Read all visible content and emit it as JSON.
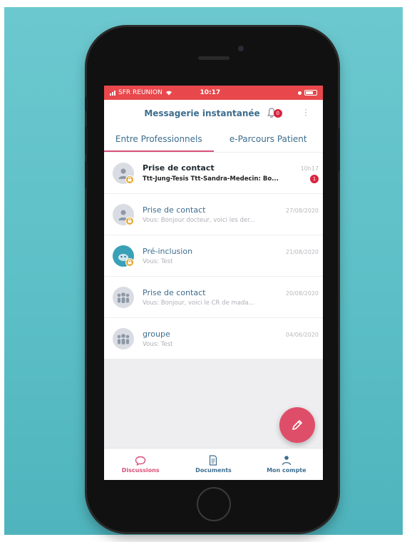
{
  "status_bar": {
    "carrier": "SFR REUNION",
    "time": "10:17"
  },
  "header": {
    "title": "Messagerie instantanée",
    "notification_count": "0"
  },
  "tabs": [
    {
      "label": "Entre Professionnels",
      "active": true
    },
    {
      "label": "e-Parcours Patient",
      "active": false
    }
  ],
  "conversations": [
    {
      "title": "Prise de contact",
      "preview": "Ttt-Jung-Tesis Ttt-Sandra-Medecin: Bo...",
      "time": "10h17",
      "unread": "1",
      "avatar_icon": "person-icon"
    },
    {
      "title": "Prise de contact",
      "preview": "Vous: Bonjour docteur, voici les der...",
      "time": "27/08/2020",
      "avatar_icon": "person-icon"
    },
    {
      "title": "Pré-inclusion",
      "preview": "Vous: Test",
      "time": "21/08/2020",
      "avatar_icon": "patient-icon"
    },
    {
      "title": "Prise de contact",
      "preview": "Vous: Bonjour, voici le CR de mada...",
      "time": "20/08/2020",
      "avatar_icon": "group-icon"
    },
    {
      "title": "groupe",
      "preview": "Vous: Test",
      "time": "04/06/2020",
      "avatar_icon": "group-icon"
    }
  ],
  "fab": {
    "icon": "pencil-icon"
  },
  "bottom_nav": [
    {
      "label": "Discussions",
      "icon": "chat-bubble-icon",
      "active": true
    },
    {
      "label": "Documents",
      "icon": "document-icon",
      "active": false
    },
    {
      "label": "Mon compte",
      "icon": "user-icon",
      "active": false
    }
  ],
  "colors": {
    "accent": "#d9507a",
    "status_bar": "#e8484c",
    "primary_text": "#3d6d8e",
    "badge": "#d9253f",
    "background": "#5bbec6"
  }
}
